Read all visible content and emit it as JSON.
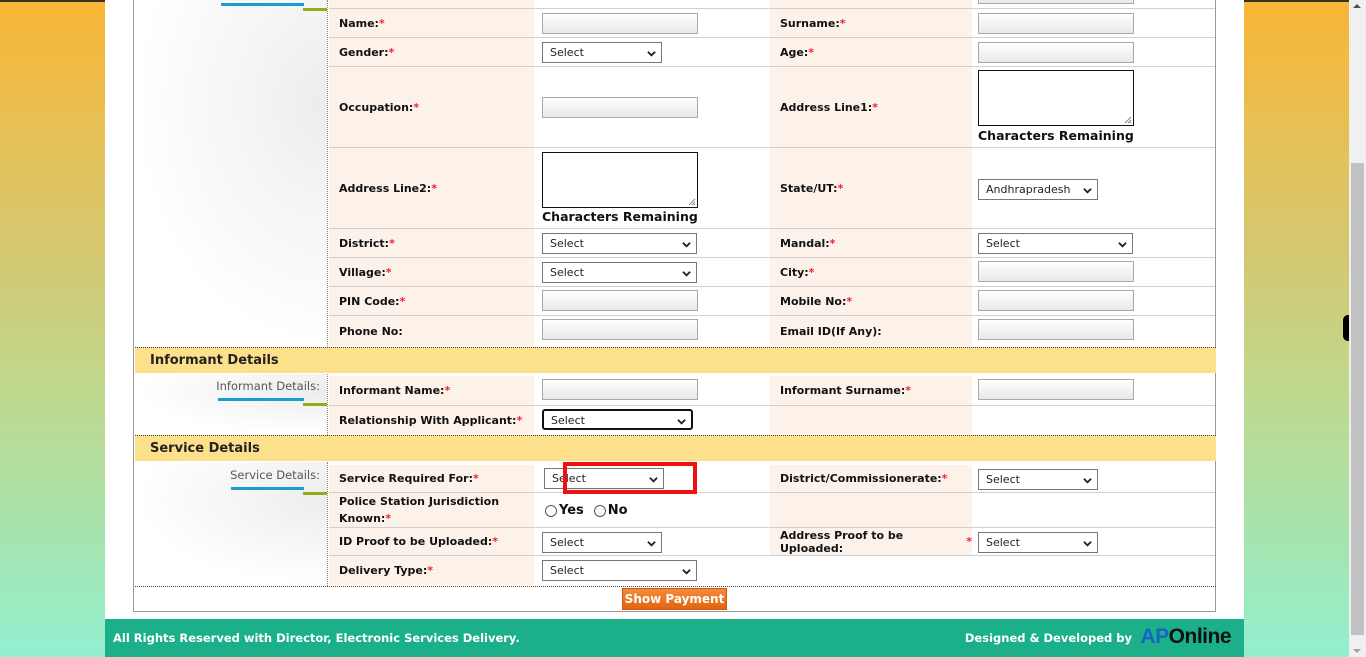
{
  "applicant": {
    "fields": {
      "name": {
        "label": "Name:",
        "required": true,
        "value": ""
      },
      "surname": {
        "label": "Surname:",
        "required": true,
        "value": ""
      },
      "gender": {
        "label": "Gender:",
        "required": true,
        "selected": "Select"
      },
      "age": {
        "label": "Age:",
        "required": true,
        "value": ""
      },
      "occupation": {
        "label": "Occupation:",
        "required": true,
        "value": ""
      },
      "address_line1": {
        "label": "Address Line1:",
        "required": true,
        "value": "",
        "counter": "Characters Remaining"
      },
      "address_line2": {
        "label": "Address Line2:",
        "required": true,
        "value": "",
        "counter": "Characters Remaining"
      },
      "state": {
        "label": "State/UT:",
        "required": true,
        "selected": "Andhrapradesh"
      },
      "district": {
        "label": "District:",
        "required": true,
        "selected": "Select"
      },
      "mandal": {
        "label": "Mandal:",
        "required": true,
        "selected": "Select"
      },
      "village": {
        "label": "Village:",
        "required": true,
        "selected": "Select"
      },
      "city": {
        "label": "City:",
        "required": true,
        "value": ""
      },
      "pin": {
        "label": "PIN Code:",
        "required": true,
        "value": ""
      },
      "mobile": {
        "label": "Mobile No:",
        "required": true,
        "value": ""
      },
      "phone": {
        "label": "Phone No:",
        "required": false,
        "value": ""
      },
      "email": {
        "label": "Email ID(If Any):",
        "required": false,
        "value": ""
      }
    }
  },
  "informant": {
    "section_title": "Informant Details",
    "side_label": "Informant Details:",
    "fields": {
      "name": {
        "label": "Informant Name:",
        "required": true,
        "value": ""
      },
      "surname": {
        "label": "Informant Surname:",
        "required": true,
        "value": ""
      },
      "relationship": {
        "label": "Relationship With Applicant:",
        "required": true,
        "selected": "Select"
      }
    }
  },
  "service": {
    "section_title": "Service Details",
    "side_label": "Service Details:",
    "fields": {
      "service_required": {
        "label": "Service Required For:",
        "required": true,
        "selected": "Select",
        "highlighted": true
      },
      "district_commissionerate": {
        "label": "District/Commissionerate:",
        "required": true,
        "selected": "Select"
      },
      "ps_jurisdiction": {
        "label_line1": "Police Station Jurisdiction",
        "label_line2": "Known:",
        "required": true,
        "options": [
          "Yes",
          "No"
        ],
        "selected": null
      },
      "id_proof": {
        "label": "ID Proof to be Uploaded:",
        "required": true,
        "selected": "Select"
      },
      "address_proof": {
        "label": "Address Proof to be Uploaded:",
        "required": true,
        "selected": "Select"
      },
      "delivery_type": {
        "label": "Delivery Type:",
        "required": true,
        "selected": "Select"
      }
    }
  },
  "actions": {
    "show_payment": "Show Payment"
  },
  "footer": {
    "rights": "All Rights Reserved with Director, Electronic Services Delivery.",
    "designed_by": "Designed & Developed by",
    "logo_ap": "AP",
    "logo_online": "Online"
  },
  "required_marker": "*",
  "colors": {
    "section_header_bg": "#fde08b",
    "label_cell_bg": "#fdf2ea",
    "footer_bg": "#1bb089",
    "button_bg": "#e36410",
    "highlight_border": "#ee1111",
    "required_star": "#ee2233"
  }
}
